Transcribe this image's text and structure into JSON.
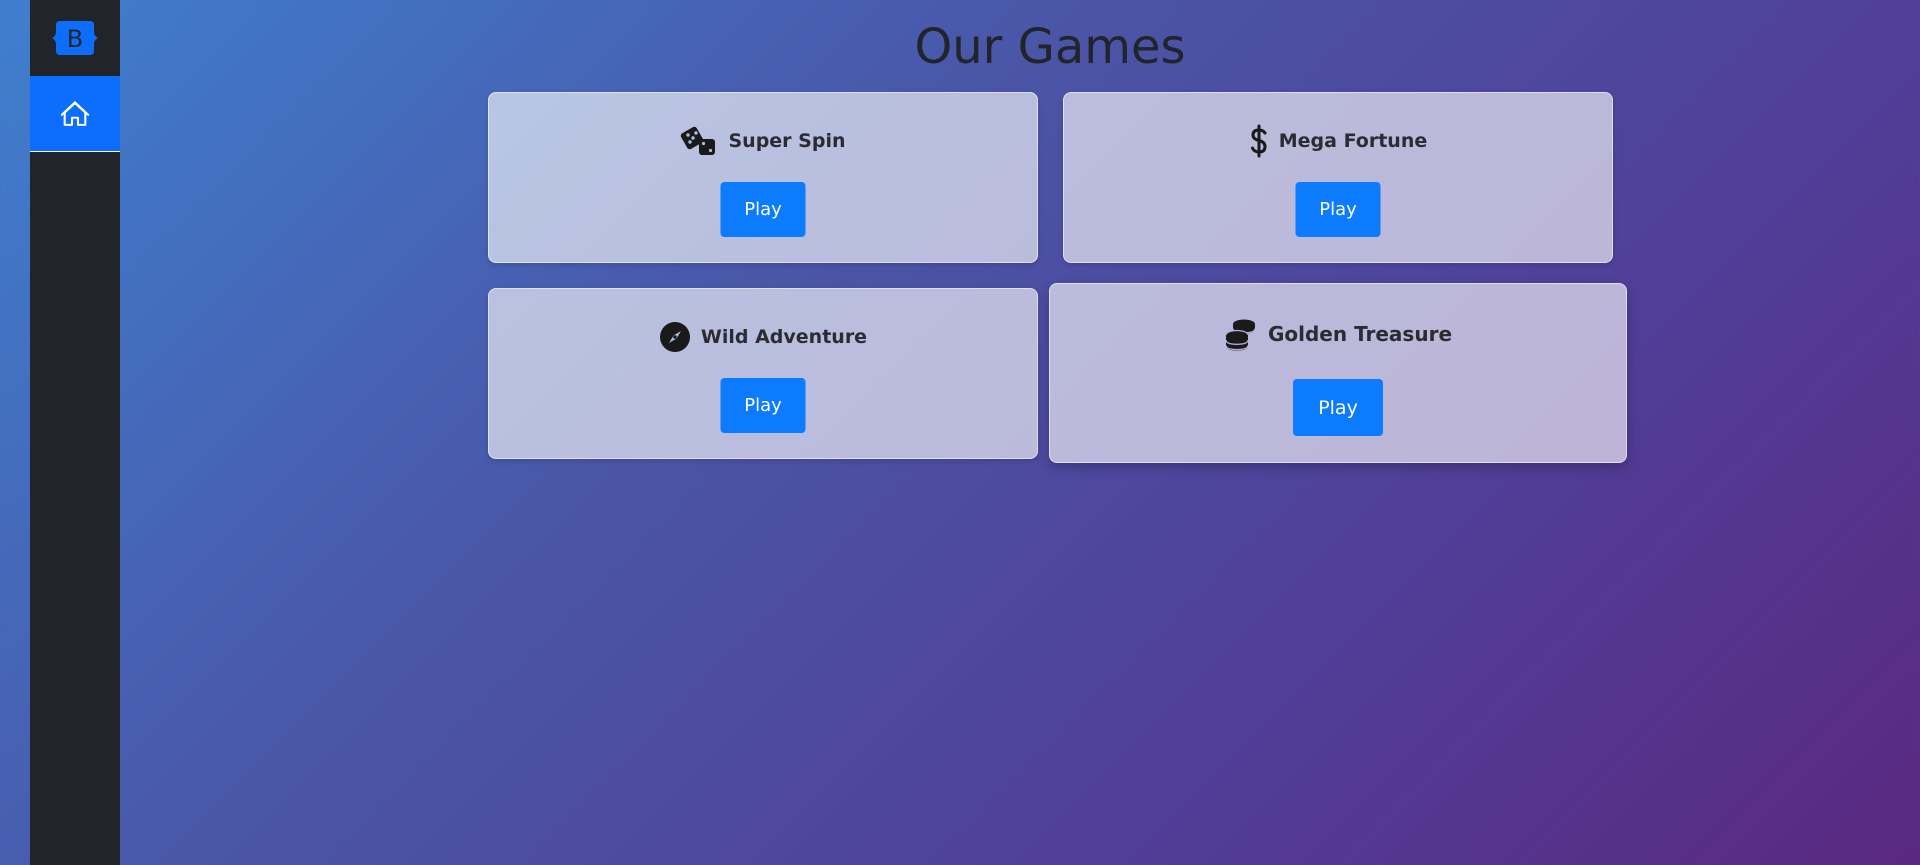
{
  "app": {
    "brand_letter": "B",
    "accent_color": "#0d6efd",
    "sidebar_color": "#212529"
  },
  "sidebar": {
    "items": [
      {
        "icon": "house-icon",
        "active": true
      }
    ]
  },
  "main": {
    "title": "Our Games",
    "games": [
      {
        "name": "Super Spin",
        "icon": "dice-icon",
        "button": "Play"
      },
      {
        "name": "Mega Fortune",
        "icon": "dollar-icon",
        "button": "Play"
      },
      {
        "name": "Wild Adventure",
        "icon": "compass-icon",
        "button": "Play"
      },
      {
        "name": "Golden Treasure",
        "icon": "coins-icon",
        "button": "Play"
      }
    ]
  }
}
